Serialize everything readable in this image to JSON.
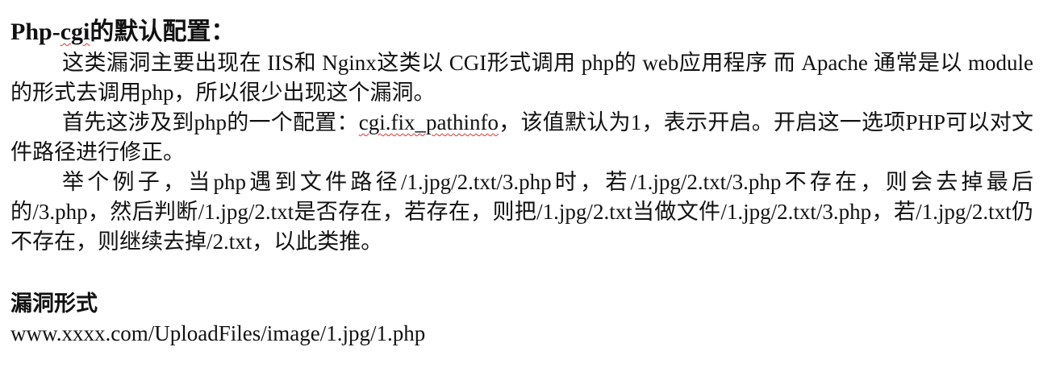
{
  "document": {
    "heading_prefix": "Php-",
    "heading_cgi": "cgi",
    "heading_suffix": "的默认配置：",
    "para1": "这类漏洞主要出现在 IIS和 Nginx这类以 CGI形式调用 php的 web应用程序 而 Apache 通常是以 module的形式去调用php，所以很少出现这个漏洞。",
    "para2_before": "首先这涉及到php的一个配置：",
    "para2_setting": "cgi.fix_pathinfo",
    "para2_after": "，该值默认为1，表示开启。开启这一选项PHP可以对文件路径进行修正。",
    "para3": "举个例子，当php遇到文件路径/1.jpg/2.txt/3.php时，若/1.jpg/2.txt/3.php不存在，则会去掉最后的/3.php，然后判断/1.jpg/2.txt是否存在，若存在，则把/1.jpg/2.txt当做文件/1.jpg/2.txt/3.php，若/1.jpg/2.txt仍不存在，则继续去掉/2.txt，以此类推。",
    "subheading": "漏洞形式",
    "url": "www.xxxx.com/UploadFiles/image/1.jpg/1.php"
  }
}
